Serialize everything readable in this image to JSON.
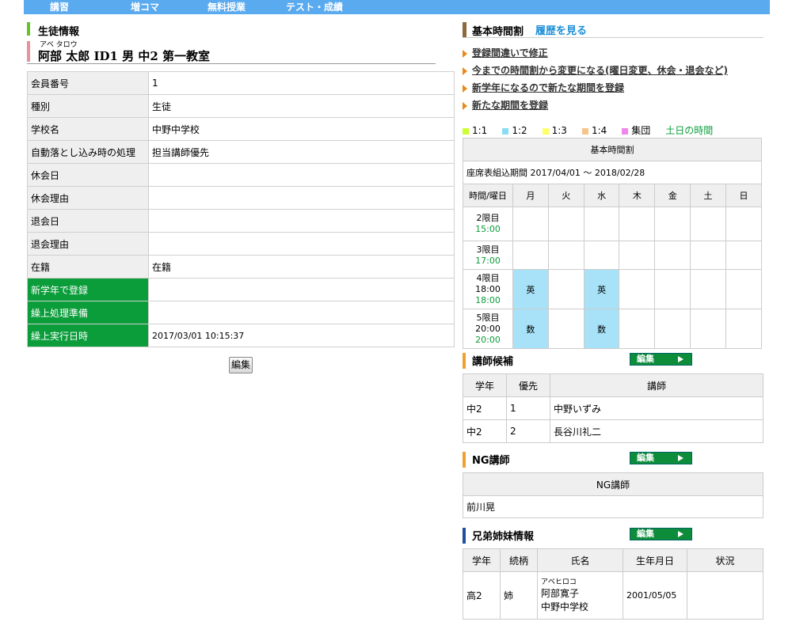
{
  "nav": {
    "items": [
      "講習",
      "増コマ",
      "無料授業",
      "テスト・成績"
    ]
  },
  "left": {
    "section_title": "生徒情報",
    "furigana": "アベ タロウ",
    "student_line": "阿部 太郎 ID1 男 中2 第一教室",
    "rows": [
      {
        "label": "会員番号",
        "value": "1"
      },
      {
        "label": "種別",
        "value": "生徒"
      },
      {
        "label": "学校名",
        "value": "中野中学校"
      },
      {
        "label": "自動落とし込み時の処理",
        "value": "担当講師優先"
      },
      {
        "label": "休会日",
        "value": ""
      },
      {
        "label": "休会理由",
        "value": ""
      },
      {
        "label": "退会日",
        "value": ""
      },
      {
        "label": "退会理由",
        "value": ""
      },
      {
        "label": "在籍",
        "value": "在籍"
      },
      {
        "label": "新学年で登録",
        "value": ""
      },
      {
        "label": "繰上処理準備",
        "value": ""
      },
      {
        "label": "繰上実行日時",
        "value": "2017/03/01 10:15:37"
      }
    ],
    "edit_button": "編集"
  },
  "right": {
    "basic_title": "基本時間割",
    "history_link": "履歴を見る",
    "links": [
      "登録間違いで修正",
      "今までの時間割から変更になる(曜日変更、休会・退会など)",
      "新学年になるので新たな期間を登録",
      "新たな期間を登録"
    ],
    "legend": [
      {
        "label": "1:1",
        "color": "#ccff33"
      },
      {
        "label": "1:2",
        "color": "#88ddf4"
      },
      {
        "label": "1:3",
        "color": "#ffff66"
      },
      {
        "label": "1:4",
        "color": "#f5c48c"
      },
      {
        "label": "集団",
        "color": "#ee88ee"
      }
    ],
    "legend_weekend": "土日の時間",
    "timetable": {
      "title": "基本時間割",
      "period": "座席表組込期間 2017/04/01 〜 2018/02/28",
      "corner": "時間/曜日",
      "days": [
        "月",
        "火",
        "水",
        "木",
        "金",
        "土",
        "日"
      ],
      "rows": [
        {
          "label": "2限目",
          "time": "",
          "time_weekend": "15:00",
          "cells": [
            "",
            "",
            "",
            "",
            "",
            "",
            ""
          ]
        },
        {
          "label": "3限目",
          "time": "",
          "time_weekend": "17:00",
          "cells": [
            "",
            "",
            "",
            "",
            "",
            "",
            ""
          ]
        },
        {
          "label": "4限目",
          "time": "18:00",
          "time_weekend": "18:00",
          "cells": [
            "英",
            "",
            "英",
            "",
            "",
            "",
            ""
          ]
        },
        {
          "label": "5限目",
          "time": "20:00",
          "time_weekend": "20:00",
          "cells": [
            "数",
            "",
            "数",
            "",
            "",
            "",
            ""
          ]
        }
      ],
      "filled_color": "#a8e2f8"
    },
    "candidates": {
      "title": "講師候補",
      "edit": "編集",
      "headers": [
        "学年",
        "優先",
        "講師"
      ],
      "rows": [
        [
          "中2",
          "1",
          "中野いずみ"
        ],
        [
          "中2",
          "2",
          "長谷川礼二"
        ]
      ]
    },
    "ng": {
      "title": "NG講師",
      "edit": "編集",
      "header": "NG講師",
      "rows": [
        "前川晃"
      ]
    },
    "siblings": {
      "title": "兄弟姉妹情報",
      "edit": "編集",
      "headers": [
        "学年",
        "続柄",
        "氏名",
        "生年月日",
        "状況"
      ],
      "row": {
        "grade": "高2",
        "relation": "姉",
        "furigana": "アベヒロコ",
        "name": "阿部寛子",
        "school": "中野中学校",
        "birth": "2001/05/05",
        "status": ""
      }
    },
    "bar_colors": {
      "basic": "#8b6a3e",
      "candidates": "#f0a030",
      "ng": "#f0a030",
      "siblings": "#1f4e9e"
    }
  }
}
